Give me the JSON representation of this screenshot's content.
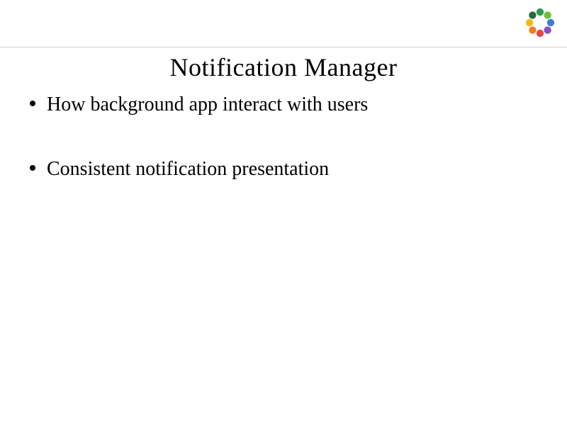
{
  "slide": {
    "title": "Notification Manager",
    "bullets": [
      "How background app interact with users",
      "Consistent notification presentation"
    ]
  },
  "logo": {
    "name": "flower-logo-icon",
    "petal_colors": [
      "#2a9d4a",
      "#6fbf3f",
      "#3a7fd5",
      "#8a4fc7",
      "#e04a4a",
      "#f07f1c",
      "#f5b81c",
      "#2a6b3a"
    ]
  }
}
